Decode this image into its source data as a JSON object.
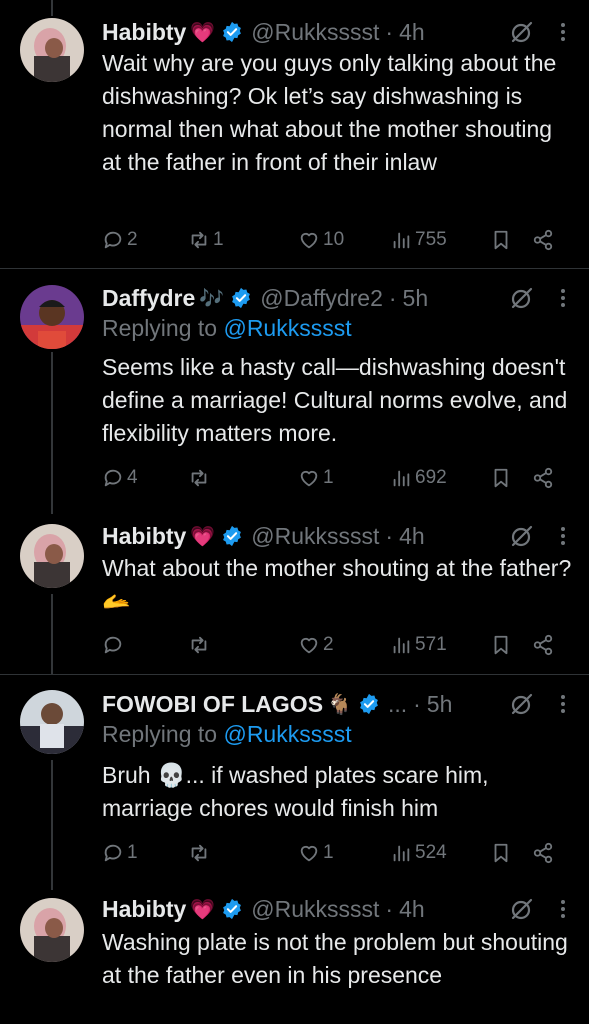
{
  "tweets": [
    {
      "name": "Habibty",
      "name_emoji": "💗",
      "handle": "@Rukksssst",
      "time": "4h",
      "reply_prefix": "",
      "reply_to": "",
      "text": "Wait why are you guys only talking about the dishwashing? Ok let’s say dishwashing is normal then what about the mother shouting at the father in front of their inlaw",
      "replies": "2",
      "reposts": "1",
      "likes": "10",
      "views": "755"
    },
    {
      "name": "Daffydre",
      "name_emoji": "🎶",
      "handle": "@Daffydre2",
      "time": "5h",
      "reply_prefix": "Replying to ",
      "reply_to": "@Rukksssst",
      "text": "Seems like a hasty call—dishwashing doesn't define a marriage! Cultural norms evolve, and flexibility matters more.",
      "replies": "4",
      "reposts": "",
      "likes": "1",
      "views": "692"
    },
    {
      "name": "Habibty",
      "name_emoji": "💗",
      "handle": "@Rukksssst",
      "time": "4h",
      "reply_prefix": "",
      "reply_to": "",
      "text": "What about the mother shouting at the father?🫴",
      "replies": "",
      "reposts": "",
      "likes": "2",
      "views": "571"
    },
    {
      "name": "FOWOBI OF LAGOS",
      "name_emoji": "🐐",
      "handle": "...",
      "time": "5h",
      "reply_prefix": "Replying to ",
      "reply_to": "@Rukksssst",
      "text": "Bruh 💀... if washed plates scare him, marriage chores would finish him",
      "replies": "1",
      "reposts": "",
      "likes": "1",
      "views": "524"
    },
    {
      "name": "Habibty",
      "name_emoji": "💗",
      "handle": "@Rukksssst",
      "time": "4h",
      "reply_prefix": "",
      "reply_to": "",
      "text": "Washing plate is not the problem but shouting at the father even in his presence",
      "replies": "",
      "reposts": "",
      "likes": "",
      "views": ""
    }
  ],
  "icons": {
    "verified": "verified-badge-icon",
    "grok": "grok-icon",
    "more": "more-icon",
    "reply": "reply-icon",
    "repost": "repost-icon",
    "like": "like-icon",
    "views": "views-icon",
    "bookmark": "bookmark-icon",
    "share": "share-icon"
  },
  "colors": {
    "background": "#000000",
    "text": "#e7e9ea",
    "secondary": "#71767b",
    "link": "#1d9bf0",
    "verified": "#1d9bf0",
    "heart": "#f91880"
  }
}
